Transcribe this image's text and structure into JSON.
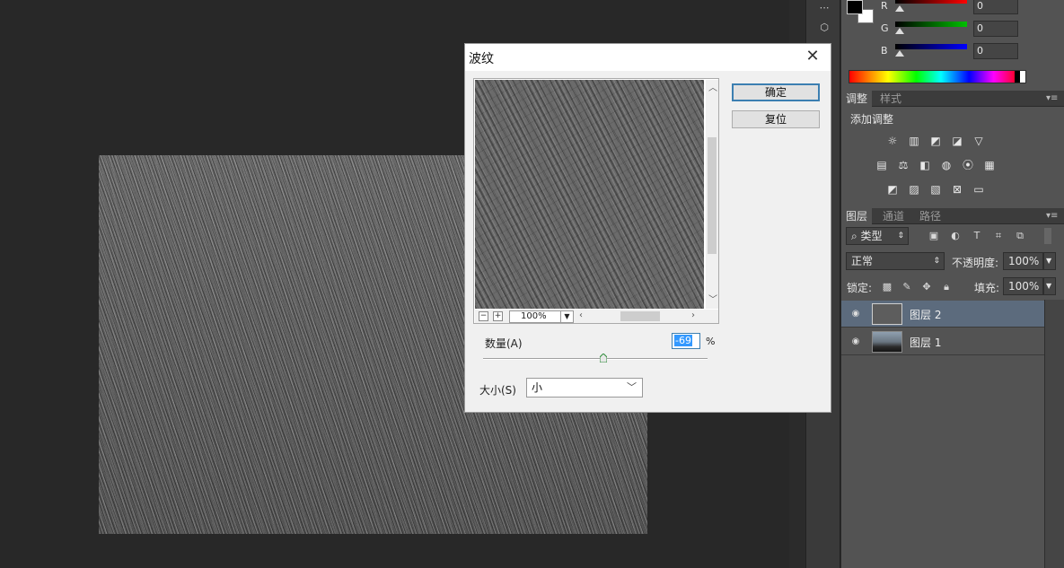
{
  "dialog": {
    "title": "波纹",
    "close_glyph": "✕",
    "ok_label": "确定",
    "reset_label": "复位",
    "zoom_minus": "−",
    "zoom_plus": "+",
    "zoom_value": "100%",
    "amount_label": "数量(A)",
    "amount_value": "-69",
    "amount_unit": "%",
    "amount_slider_fraction": 0.535,
    "size_label": "大小(S)",
    "size_value": "小"
  },
  "color_panel": {
    "channels": [
      {
        "label": "R",
        "value": "0",
        "color": "#ff0000"
      },
      {
        "label": "G",
        "value": "0",
        "color": "#00c000"
      },
      {
        "label": "B",
        "value": "0",
        "color": "#0000ff"
      }
    ]
  },
  "adjust_panel": {
    "tabs": [
      "调整",
      "样式"
    ],
    "title": "添加调整",
    "icons": [
      "brightness-icon",
      "levels-icon",
      "curves-icon",
      "exposure-icon",
      "vibrance-icon",
      "hue-saturation-icon",
      "color-balance-icon",
      "black-white-icon",
      "photo-filter-icon",
      "channel-mixer-icon",
      "color-lookup-icon",
      "invert-icon",
      "posterize-icon",
      "threshold-icon",
      "selective-color-icon",
      "gradient-map-icon"
    ]
  },
  "layers_panel": {
    "tabs": [
      "图层",
      "通道",
      "路径"
    ],
    "filter_label": "类型",
    "blend_mode": "正常",
    "opacity_label": "不透明度:",
    "opacity_value": "100%",
    "lock_label": "锁定:",
    "fill_label": "填充:",
    "fill_value": "100%",
    "layers": [
      {
        "name": "图层 2",
        "selected": true
      },
      {
        "name": "图层 1",
        "selected": false
      }
    ]
  }
}
